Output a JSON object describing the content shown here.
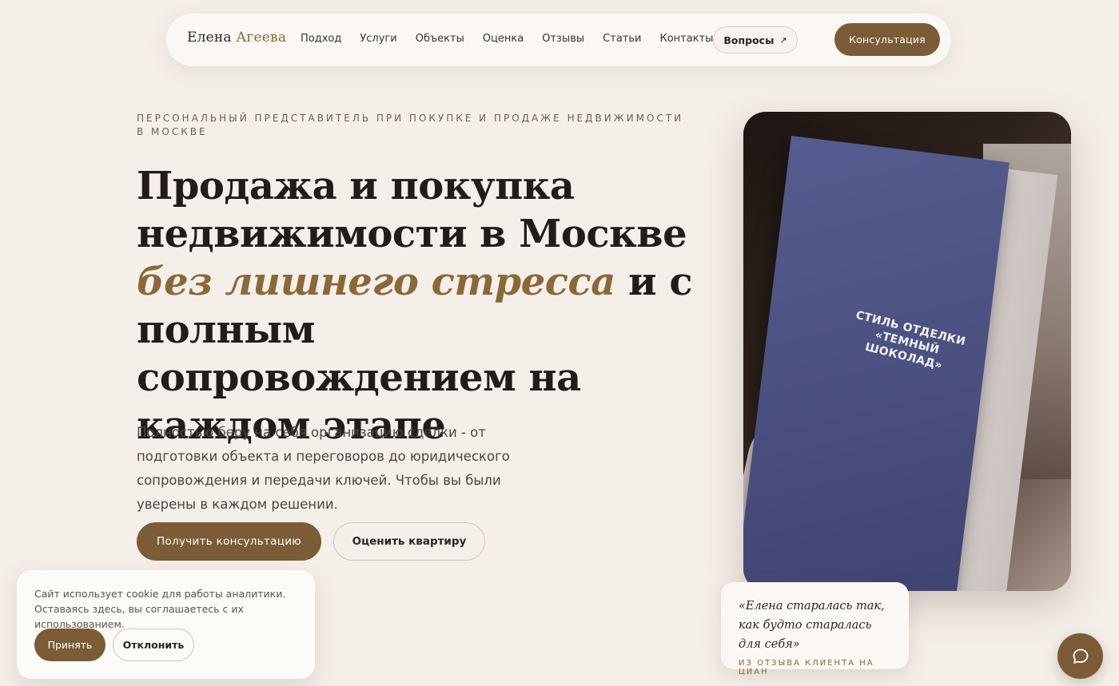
{
  "nav": {
    "logo_first": "Елена",
    "logo_last": "Агеева",
    "links": [
      {
        "label": "Подход"
      },
      {
        "label": "Услуги"
      },
      {
        "label": "Объекты"
      },
      {
        "label": "Оценка"
      },
      {
        "label": "Отзывы"
      },
      {
        "label": "Статьи"
      },
      {
        "label": "Контакты"
      }
    ],
    "questions_label": "Вопросы",
    "questions_arrow": "↗",
    "consult_label": "Консультация"
  },
  "hero": {
    "kicker": "Персональный представитель при покупке и продаже недвижимости в Москве",
    "headline_part1": "Продажа и покупка недвижимости в Москве ",
    "headline_accent": "без лишнего стресса",
    "headline_part2": " и с полным сопровождением на каждом этапе",
    "lead": "Полностью беру на себя организацию сделки - от подготовки объекта и переговоров до юридического сопровождения и передачи ключей. Чтобы вы были уверены в каждом решении.",
    "primary_button": "Получить консультацию",
    "secondary_button": "Оценить квартиру"
  },
  "photo": {
    "booklet_line1": "СТИЛЬ ОТДЕЛКИ",
    "booklet_line2": "«ТЕМНЫЙ ШОКОЛАД»"
  },
  "quote": {
    "text": "«Елена старалась так, как будто старалась для себя»",
    "source": "Из отзыва клиента на ЦИАН"
  },
  "cookie": {
    "text": "Сайт использует cookie для работы аналитики. Оставаясь здесь, вы соглашаетесь с их использованием.",
    "accept": "Принять",
    "decline": "Отклонить"
  },
  "colors": {
    "background": "#f5efe9",
    "accent": "#7b5c36",
    "accent_text": "#8a6838"
  },
  "icons": {
    "chat": "chat-bubble-icon",
    "arrow": "arrow-up-right-icon"
  }
}
